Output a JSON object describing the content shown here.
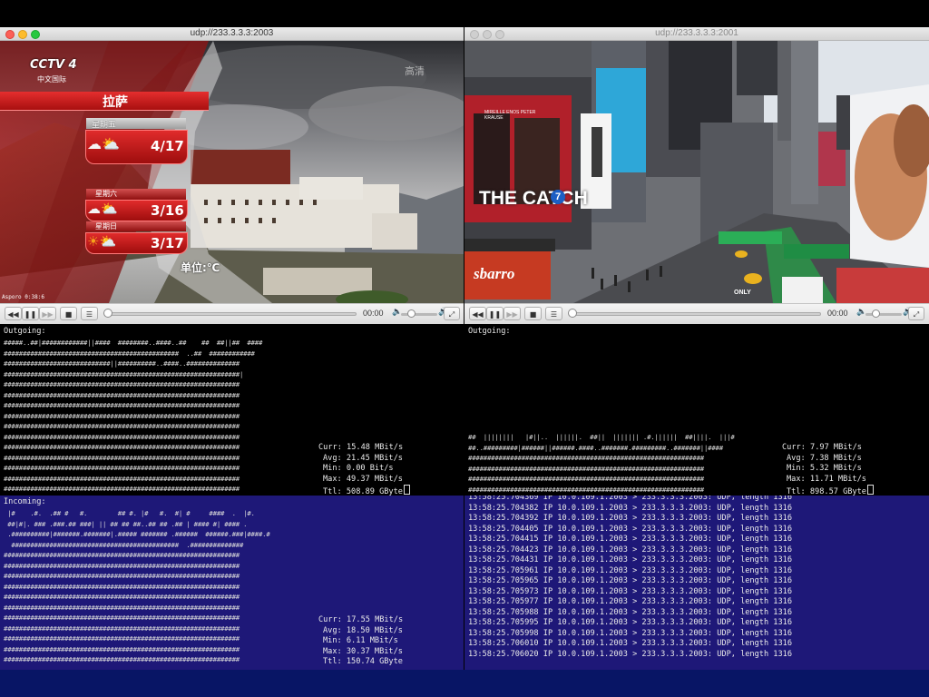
{
  "left_player": {
    "title": "udp://233.3.3.3:2003",
    "time": "00:00",
    "channel_logo": "CCTV 4",
    "channel_sub": "中文国际",
    "corner_watermark": "高清",
    "city": "拉萨",
    "forecast": [
      {
        "day": "星期五",
        "icon": "cloud-sun-rain-icon",
        "temp": "4/17"
      },
      {
        "day": "星期六",
        "icon": "cloud-sun-icon",
        "temp": "3/16"
      },
      {
        "day": "星期日",
        "icon": "sun-cloud-icon",
        "temp": "3/17"
      }
    ],
    "unit": "单位:℃",
    "caption": "Asporo 0:38:6"
  },
  "right_player": {
    "title": "udp://233.3.3.3:2001",
    "time": "00:00",
    "billboard_text": "THE CATCH",
    "billboard_num": "7",
    "poster_credit": "MIREILLE ENOS PETER KRAUSE",
    "shop_sign": "sbarro",
    "street_sign": "ONLY"
  },
  "left_terminal": {
    "outgoing_label": "Outgoing:",
    "outgoing_bars": [
      "#####..##|############||####  ########..####..##    ##  ##||##  ####",
      "##############################################  ..##  ############",
      "############################||##########..####..##############",
      "##############################################################|",
      "##############################################################",
      "##############################################################",
      "##############################################################",
      "##############################################################",
      "##############################################################",
      "##############################################################",
      "##############################################################",
      "##############################################################",
      "##############################################################",
      "##############################################################",
      "##############################################################",
      "##############################################################"
    ],
    "outgoing_stats": [
      "Curr: 15.48 MBit/s",
      "Avg: 21.45 MBit/s",
      "Min: 0.00 Bit/s",
      "Max: 49.37 MBit/s",
      "Ttl: 508.89 GByte"
    ],
    "incoming_label": "Incoming:",
    "incoming_bars": [
      " |#    .#.  .## #   #.        ## #. |#   #.  #| #     ####  .  |#.",
      " ##|#|. ### .###.## ###| || ## ## ##..## ## .## | #### #| #### .",
      " .##########|#######.#######|.##### ####### .######  ######.###|####.#",
      "  ############################################  .##############",
      "##############################################################",
      "##############################################################",
      "##############################################################",
      "##############################################################",
      "##############################################################",
      "##############################################################",
      "##############################################################",
      "##############################################################",
      "##############################################################",
      "##############################################################",
      "##############################################################"
    ],
    "incoming_stats": [
      "Curr: 17.55 MBit/s",
      "Avg: 18.50 MBit/s",
      "Min: 6.11 MBit/s",
      "Max: 30.37 MBit/s",
      "Ttl: 150.74 GByte"
    ]
  },
  "right_terminal": {
    "outgoing_label": "Outgoing:",
    "outgoing_bars": [
      "##  ||||||||   |#||..  ||||||.  ##||  ||||||| .#.||||||  ##||||.  |||#",
      "##..#########|######||######.####..#######.#########..#######||####",
      "##############################################################",
      "##############################################################",
      "##############################################################",
      "##############################################################"
    ],
    "outgoing_stats": [
      "Curr: 7.97 MBit/s",
      "Avg: 7.38 MBit/s",
      "Min: 5.32 MBit/s",
      "Max: 11.71 MBit/s",
      "Ttl: 898.57 GByte"
    ],
    "dump_lines": [
      "13:58:25.704369 IP 10.0.109.1.2003 > 233.3.3.3.2003: UDP, length 1316",
      "13:58:25.704382 IP 10.0.109.1.2003 > 233.3.3.3.2003: UDP, length 1316",
      "13:58:25.704392 IP 10.0.109.1.2003 > 233.3.3.3.2003: UDP, length 1316",
      "13:58:25.704405 IP 10.0.109.1.2003 > 233.3.3.3.2003: UDP, length 1316",
      "13:58:25.704415 IP 10.0.109.1.2003 > 233.3.3.3.2003: UDP, length 1316",
      "13:58:25.704423 IP 10.0.109.1.2003 > 233.3.3.3.2003: UDP, length 1316",
      "13:58:25.704431 IP 10.0.109.1.2003 > 233.3.3.3.2003: UDP, length 1316",
      "13:58:25.705961 IP 10.0.109.1.2003 > 233.3.3.3.2003: UDP, length 1316",
      "13:58:25.705965 IP 10.0.109.1.2003 > 233.3.3.3.2003: UDP, length 1316",
      "13:58:25.705973 IP 10.0.109.1.2003 > 233.3.3.3.2003: UDP, length 1316",
      "13:58:25.705977 IP 10.0.109.1.2003 > 233.3.3.3.2003: UDP, length 1316",
      "13:58:25.705988 IP 10.0.109.1.2003 > 233.3.3.3.2003: UDP, length 1316",
      "13:58:25.705995 IP 10.0.109.1.2003 > 233.3.3.3.2003: UDP, length 1316",
      "13:58:25.705998 IP 10.0.109.1.2003 > 233.3.3.3.2003: UDP, length 1316",
      "13:58:25.706010 IP 10.0.109.1.2003 > 233.3.3.3.2003: UDP, length 1316",
      "13:58:25.706020 IP 10.0.109.1.2003 > 233.3.3.3.2003: UDP, length 1316"
    ]
  },
  "controls": {
    "rewind_icon": "rewind-icon",
    "pause_icon": "pause-icon",
    "forward_icon": "fast-forward-icon",
    "stop_icon": "stop-icon",
    "playlist_icon": "playlist-icon",
    "fullscreen_icon": "fullscreen-icon",
    "volume_low_icon": "volume-low-icon",
    "volume_high_icon": "volume-high-icon"
  },
  "colors": {
    "terminal_bg": "#000000",
    "incoming_bg": "#1e1878",
    "weather_red": "#c81b1b",
    "window_chrome": "#ececec"
  }
}
